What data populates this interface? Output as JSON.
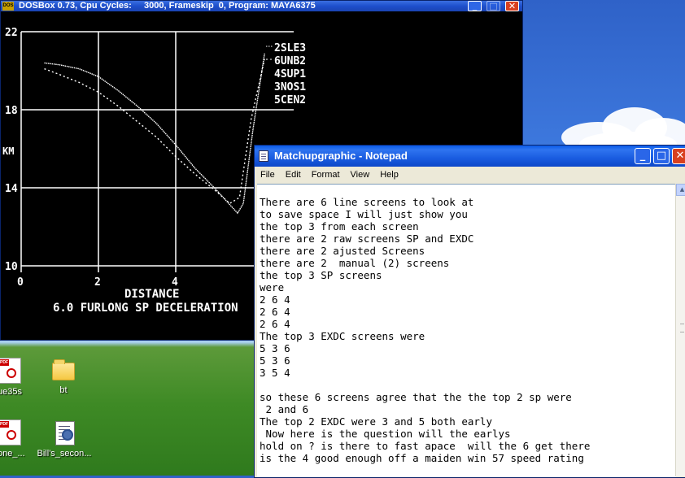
{
  "dosbox": {
    "title": "DOSBox 0.73, Cpu Cycles:     3000, Frameskip  0, Program: MAYA6375",
    "icon_label": "DOS\nBOX",
    "buttons": {
      "minimize": "_",
      "maximize": "□",
      "close": "✕"
    }
  },
  "chart_data": {
    "type": "line",
    "title": "6.0 FURLONG SP DECELERATION",
    "xlabel": "DISTANCE",
    "ylabel": "KM",
    "xlim": [
      0,
      6
    ],
    "ylim": [
      10,
      22
    ],
    "x_ticks": [
      "0",
      "2",
      "4"
    ],
    "y_ticks": [
      "22",
      "18",
      "14",
      "10"
    ],
    "grid": true,
    "legend_placement": "top-right",
    "legend": [
      "2SLE3",
      "6UNB2",
      "4SUP1",
      "3NOS1",
      "5CEN2"
    ],
    "series": [
      {
        "name": "2SLE3",
        "style": "solid",
        "x": [
          0.6,
          1.0,
          1.5,
          2.0,
          2.5,
          3.0,
          3.5,
          4.0,
          4.5,
          5.0,
          5.6,
          5.75,
          6.0,
          6.3
        ],
        "y": [
          20.4,
          20.3,
          20.1,
          19.7,
          19.0,
          18.2,
          17.3,
          16.2,
          15.0,
          14.0,
          12.7,
          13.2,
          17.0,
          20.9
        ]
      },
      {
        "name": "6UNB2",
        "style": "dotted",
        "x": [
          0.6,
          1.0,
          1.5,
          2.0,
          2.5,
          3.0,
          3.5,
          4.0,
          4.5,
          5.0,
          5.4,
          5.65,
          5.95,
          6.3
        ],
        "y": [
          20.1,
          19.8,
          19.4,
          18.9,
          18.2,
          17.4,
          16.6,
          15.6,
          14.7,
          13.9,
          13.2,
          13.5,
          17.5,
          20.6
        ]
      }
    ]
  },
  "notepad": {
    "title": "Matchupgraphic - Notepad",
    "buttons": {
      "minimize": "_",
      "maximize": "□",
      "close": "✕"
    },
    "menu": [
      "File",
      "Edit",
      "Format",
      "View",
      "Help"
    ],
    "content": "There are 6 line screens to look at\nto save space I will just show you\nthe top 3 from each screen\nthere are 2 raw screens SP and EXDC\nthere are 2 ajusted Screens\nthere are 2  manual (2) screens\nthe top 3 SP screens\nwere\n2 6 4\n2 6 4\n2 6 4\nThe top 3 EXDC screens were\n5 3 6\n5 3 6\n3 5 4\n\nso these 6 screens agree that the the top 2 sp were\n 2 and 6\nThe top 2 EXDC were 3 and 5 both early\n Now here is the question will the earlys\nhold on ? is there to fast apace  will the 6 get there\nis the 4 good enough off a maiden win 57 speed rating"
  },
  "desktop_icons": [
    {
      "label": "ue35s",
      "icon": "pdf-icon"
    },
    {
      "label": "bt",
      "icon": "folder-icon"
    },
    {
      "label": "rone_...",
      "icon": "pdf-icon"
    },
    {
      "label": "Bill's_secon...",
      "icon": "document-icon"
    }
  ]
}
